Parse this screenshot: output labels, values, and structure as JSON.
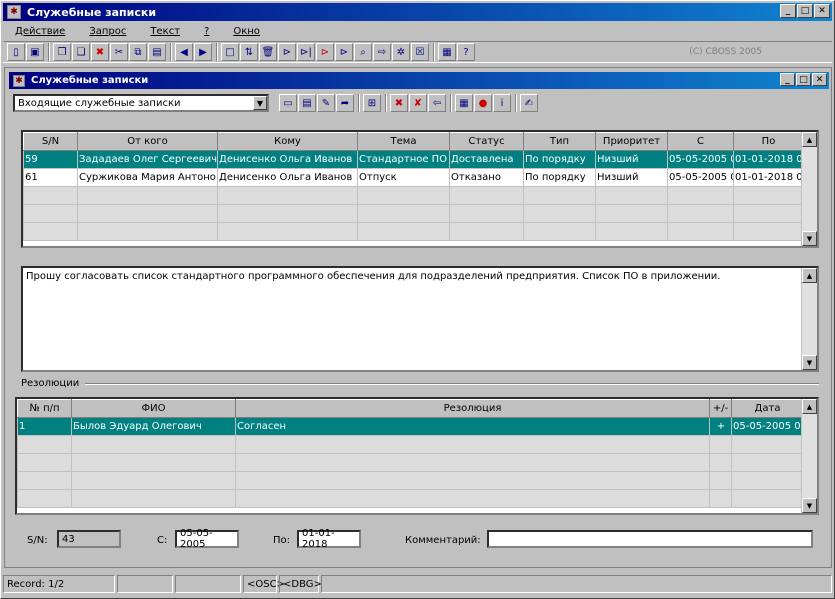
{
  "window": {
    "title": "Служебные записки",
    "icon": "app-icon"
  },
  "menu": [
    {
      "label": "Действие"
    },
    {
      "label": "Запрос"
    },
    {
      "label": "Текст"
    },
    {
      "label": "?"
    },
    {
      "label": "Окно"
    }
  ],
  "copyright": "(C) CBOSS 2005",
  "inner": {
    "title": "Служебные записки",
    "filter_value": "Входящие служебные записки"
  },
  "notes_table": {
    "columns": [
      "S/N",
      "От кого",
      "Кому",
      "Тема",
      "Статус",
      "Тип",
      "Приоритет",
      "С",
      "По"
    ],
    "rows": [
      {
        "sn": "59",
        "from": "Зададаев Олег Сергеевич",
        "to": "Денисенко Ольга Иванов",
        "topic": "Стандартное ПО",
        "status": "Доставлена",
        "type": "По порядку",
        "priority": "Низший",
        "from_date": "05-05-2005 0",
        "to_date": "01-01-2018 0",
        "selected": true
      },
      {
        "sn": "61",
        "from": "Суржикова Мария Антоно",
        "to": "Денисенко Ольга Иванов",
        "topic": "Отпуск",
        "status": "Отказано",
        "type": "По порядку",
        "priority": "Низший",
        "from_date": "05-05-2005 0",
        "to_date": "01-01-2018 0",
        "selected": false
      }
    ]
  },
  "memo_text": "Прошу согласовать список стандартного программного обеспечения для подразделений предприятия. Список ПО  в приложении.",
  "resolutions": {
    "label": "Резолюции",
    "columns": [
      "№ п/п",
      "ФИО",
      "Резолюция",
      "+/-",
      "Дата"
    ],
    "rows": [
      {
        "num": "1",
        "name": "Былов Эдуард Олегович",
        "resolution": "Согласен",
        "sign": "+",
        "date": "05-05-2005 0"
      }
    ]
  },
  "footer": {
    "sn_label": "S/N:",
    "sn_value": "43",
    "from_label": "С:",
    "from_value": "05-05-2005",
    "to_label": "По:",
    "to_value": "01-01-2018",
    "comment_label": "Комментарий:",
    "comment_value": ""
  },
  "status_bar": {
    "record": "Record: 1/2",
    "osc": "<OSC>",
    "dbg": "<DBG>"
  }
}
